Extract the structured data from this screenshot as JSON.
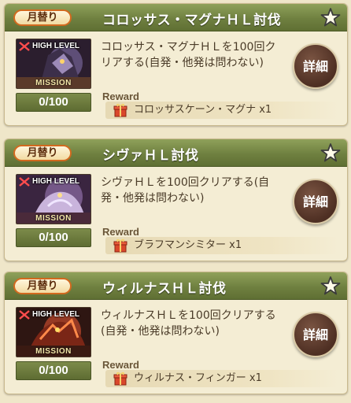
{
  "missions": [
    {
      "badge": "月替り",
      "title": "コロッサス・マグナＨＬ討伐",
      "thumb_level": "HIGH LEVEL",
      "thumb_mission": "MISSION",
      "progress": "0/100",
      "description": "コロッサス・マグナＨＬを100回クリアする(自発・他発は問わない)",
      "detail_label": "詳細",
      "reward_label": "Reward",
      "reward_item": "コロッサスケーン・マグナ x1",
      "art_color": "#6b5a8a"
    },
    {
      "badge": "月替り",
      "title": "シヴァＨＬ討伐",
      "thumb_level": "HIGH LEVEL",
      "thumb_mission": "MISSION",
      "progress": "0/100",
      "description": "シヴァＨＬを100回クリアする(自発・他発は問わない)",
      "detail_label": "詳細",
      "reward_label": "Reward",
      "reward_item": "ブラフマンシミター x1",
      "art_color": "#8a6aa0"
    },
    {
      "badge": "月替り",
      "title": "ウィルナスＨＬ討伐",
      "thumb_level": "HIGH LEVEL",
      "thumb_mission": "MISSION",
      "progress": "0/100",
      "description": "ウィルナスＨＬを100回クリアする(自発・他発は問わない)",
      "detail_label": "詳細",
      "reward_label": "Reward",
      "reward_item": "ウィルナス・フィンガー x1",
      "art_color": "#b0442a"
    }
  ],
  "colors": {
    "header": "#6f8040",
    "badge_border": "#d2691e",
    "detail_button": "#4e2f23",
    "progress": "#6b7a3c"
  }
}
